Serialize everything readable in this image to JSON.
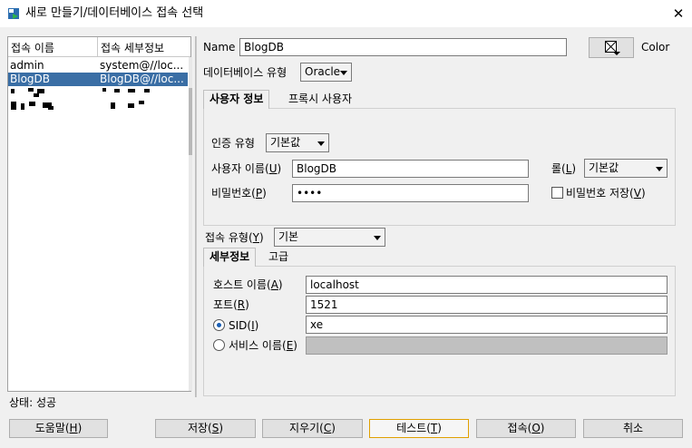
{
  "window": {
    "title": "새로 만들기/데이터베이스 접속 선택",
    "close_glyph": "✕"
  },
  "connections": {
    "columns": [
      "접속 이름",
      "접속 세부정보"
    ],
    "rows": [
      {
        "name": "admin",
        "details": "system@//loc..."
      },
      {
        "name": "BlogDB",
        "details": "BlogDB@//loc...",
        "selected": true
      }
    ]
  },
  "form": {
    "name_label": "Name",
    "name_value": "BlogDB",
    "color_label": "Color",
    "db_type_label": "데이터베이스 유형",
    "db_type_value": "Oracle",
    "tabs": [
      "사용자 정보",
      "프록시 사용자"
    ],
    "auth_type_label": "인증 유형",
    "auth_type_value": "기본값",
    "username_label": "사용자 이름(",
    "username_key": "U",
    "username_value": "BlogDB",
    "role_label": "롤(",
    "role_key": "L",
    "role_value": "기본값",
    "password_label": "비밀번호(",
    "password_key": "P",
    "password_value": "••••",
    "save_password_label": "비밀번호 저장(",
    "save_password_key": "V",
    "conn_type_label": "접속 유형(",
    "conn_type_key": "Y",
    "conn_type_value": "기본",
    "detail_tabs": [
      "세부정보",
      "고급"
    ],
    "host_label": "호스트 이름(",
    "host_key": "A",
    "host_value": "localhost",
    "port_label": "포트(",
    "port_key": "R",
    "port_value": "1521",
    "sid_label": "SID(",
    "sid_key": "I",
    "sid_value": "xe",
    "service_label": "서비스 이름(",
    "service_key": "E",
    "service_value": ""
  },
  "status": "상태: 성공",
  "buttons": {
    "help": {
      "label": "도움말(",
      "key": "H"
    },
    "save": {
      "label": "저장(",
      "key": "S"
    },
    "clear": {
      "label": "지우기(",
      "key": "C"
    },
    "test": {
      "label": "테스트(",
      "key": "T"
    },
    "connect": {
      "label": "접속(",
      "key": "O"
    },
    "cancel": {
      "label": "취소"
    }
  },
  "colors": {
    "selection": "#3a6ea5",
    "focus_border": "#e0a000",
    "radio_dot": "#1a5fb4"
  },
  "icons": [
    "database-connection-icon",
    "close-icon",
    "color-picker-icon",
    "dropdown-arrow-icon"
  ]
}
